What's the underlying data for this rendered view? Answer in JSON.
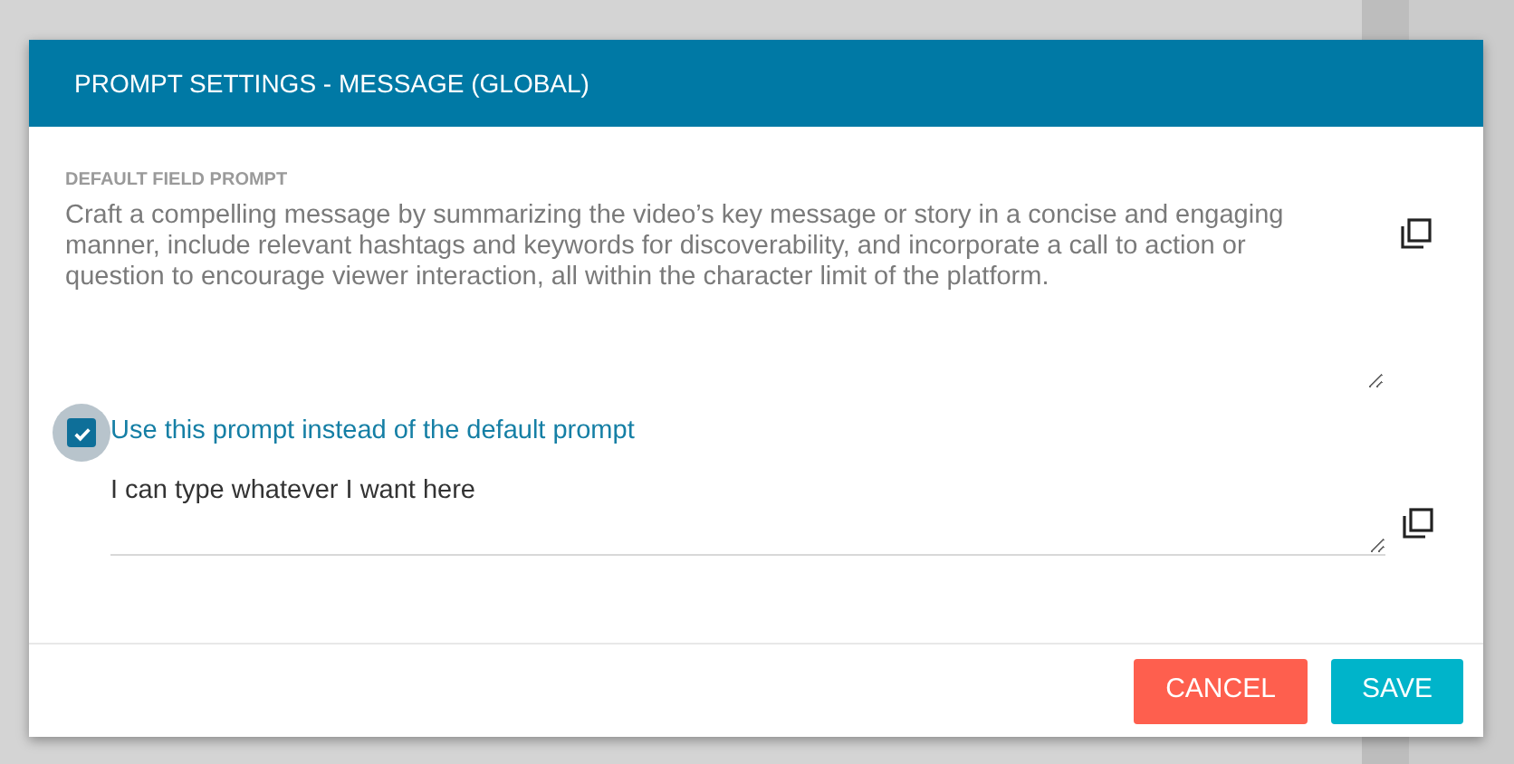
{
  "dialog": {
    "title": "PROMPT SETTINGS - MESSAGE (GLOBAL)",
    "default_prompt": {
      "label": "DEFAULT FIELD PROMPT",
      "value": "Craft a compelling message by summarizing the video’s key message or story in a concise and engaging manner, include relevant hashtags and keywords for discoverability, and incorporate a call to action or question to encourage viewer interaction, all within the character limit of the platform."
    },
    "override": {
      "label": "Use this prompt instead of the default prompt",
      "checked": true
    },
    "custom_prompt": {
      "value": "I can type whatever I want here"
    },
    "buttons": [
      {
        "label": "CANCEL",
        "kind": "cancel"
      },
      {
        "label": "SAVE",
        "kind": "save"
      }
    ]
  }
}
